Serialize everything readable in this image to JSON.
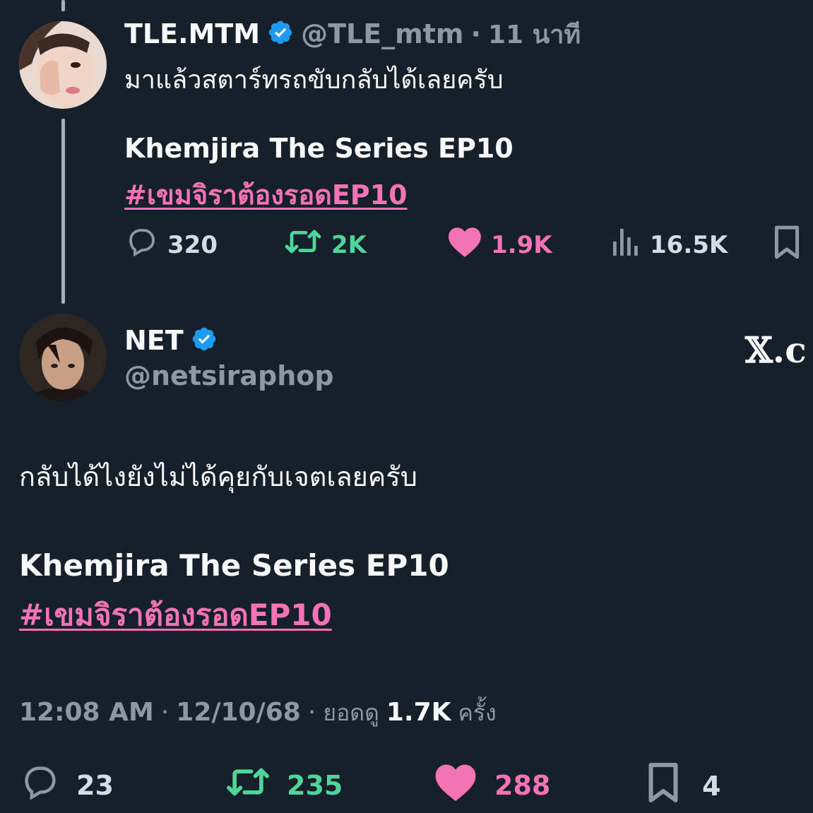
{
  "colors": {
    "background": "#15202b",
    "text": "#f7f9f9",
    "muted": "#8b98a5",
    "hashtag": "#f472b6",
    "retweet": "#4ed69a",
    "like": "#f472b6",
    "verified": "#1d9bf0"
  },
  "quoted_tweet": {
    "display_name": "TLE.MTM",
    "handle": "@TLE_mtm",
    "separator": "·",
    "time": "11 นาที",
    "text_line": "มาแล้วสตาร์ทรถขับกลับได้เลยครับ",
    "title_line": "Khemjira The Series EP10",
    "hashtag": "#เขมจิราต้องรอดEP10",
    "stats": {
      "replies": "320",
      "retweets": "2K",
      "likes": "1.9K",
      "views": "16.5K"
    },
    "icons": [
      "avatar",
      "verified-badge-icon",
      "reply-icon",
      "retweet-icon",
      "heart-icon",
      "views-icon",
      "bookmark-icon"
    ]
  },
  "main_tweet": {
    "display_name": "NET",
    "handle": "@netsiraphop",
    "watermark": "𝕏.c",
    "text_line": "กลับได้ไงยังไม่ได้คุยกับเจตเลยครับ",
    "title_line": "Khemjira The Series EP10",
    "hashtag": "#เขมจิราต้องรอดEP10",
    "time": "12:08 AM",
    "dot1": "·",
    "date": "12/10/68",
    "dot2": "·",
    "views_label": "ยอดดู",
    "views_count": "1.7K",
    "views_suffix": "ครั้ง",
    "stats": {
      "replies": "23",
      "retweets": "235",
      "likes": "288",
      "bookmarks": "4"
    }
  }
}
